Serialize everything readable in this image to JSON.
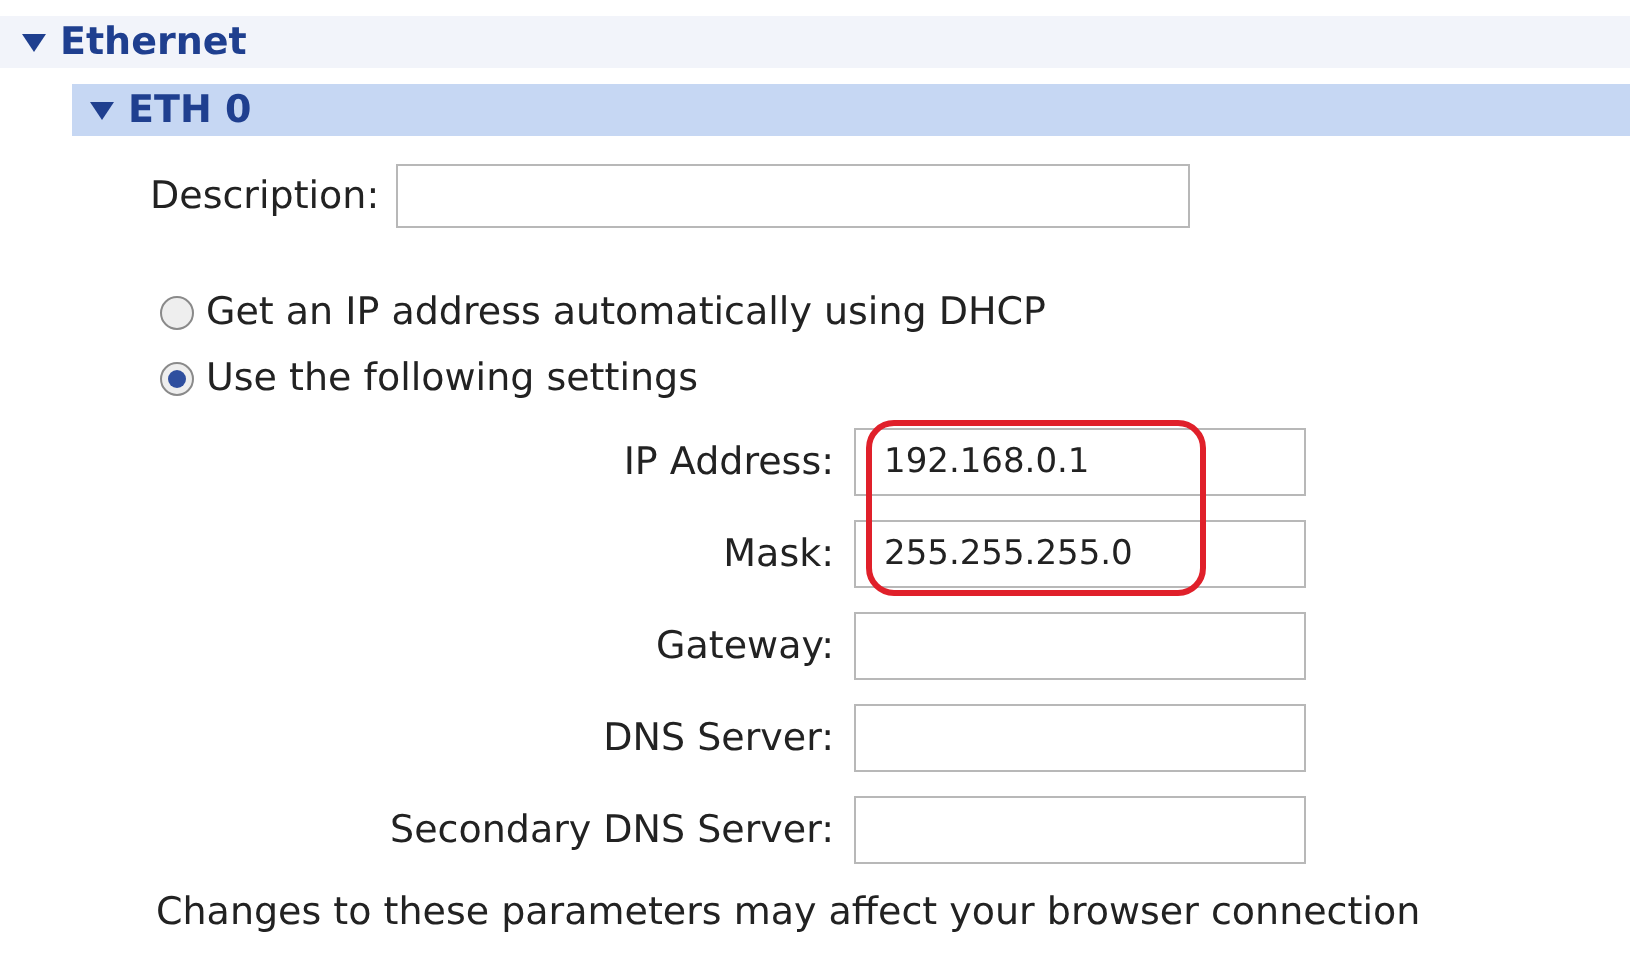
{
  "section": {
    "title": "Ethernet",
    "expanded": true
  },
  "subsection": {
    "title": "ETH 0",
    "expanded": true
  },
  "description": {
    "label": "Description:"
  },
  "ip_mode": [
    {
      "label": "Get an IP address automatically using DHCP",
      "selected": false
    },
    {
      "label": "Use the following settings",
      "selected": true
    }
  ],
  "fields": [
    {
      "label": "IP Address:",
      "value": "192.168.0.1",
      "highlighted": true
    },
    {
      "label": "Mask:",
      "value": "255.255.255.0",
      "highlighted": true
    },
    {
      "label": "Gateway:",
      "highlighted": false
    },
    {
      "label": "DNS Server:",
      "highlighted": false
    },
    {
      "label": "Secondary DNS Server:",
      "highlighted": false
    }
  ],
  "note": "Changes to these parameters may affect your browser connection"
}
